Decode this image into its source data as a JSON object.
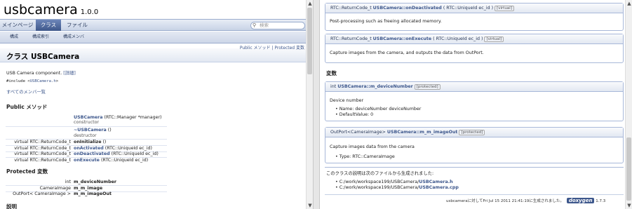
{
  "left": {
    "project_name": "usbcamera",
    "project_version": "1.0.0",
    "main_tabs": [
      "メインページ",
      "クラス",
      "ファイル"
    ],
    "search_placeholder": "検索",
    "sub_tabs": [
      "構成",
      "構成索引",
      "構成メンバ"
    ],
    "summary_links": [
      "Public メソッド",
      "Protected 変数"
    ],
    "summary_separator": " | ",
    "page_title": "クラス USBCamera",
    "brief": "USB Camera component.",
    "detail_link": "[詳細]",
    "include_prefix": "#include <",
    "include_file": "USBCamera.h",
    "include_suffix": ">",
    "all_members_link": "すべてのメンバ一覧",
    "public_methods_heading": "Public メソッド",
    "methods": [
      {
        "type": "",
        "name": "USBCamera",
        "args": " (RTC::Manager *manager)",
        "desc": "constructor"
      },
      {
        "type": "",
        "name": "~USBCamera",
        "args": " ()",
        "desc": "destructor"
      },
      {
        "type": "virtual RTC::ReturnCode_t",
        "name": "onInitialize",
        "args": " ()",
        "desc": ""
      },
      {
        "type": "virtual RTC::ReturnCode_t",
        "name": "onActivated",
        "args": " (RTC::UniqueId ec_id)",
        "desc": ""
      },
      {
        "type": "virtual RTC::ReturnCode_t",
        "name": "onDeactivated",
        "args": " (RTC::UniqueId ec_id)",
        "desc": ""
      },
      {
        "type": "virtual RTC::ReturnCode_t",
        "name": "onExecute",
        "args": " (RTC::UniqueId ec_id)",
        "desc": ""
      }
    ],
    "protected_vars_heading": "Protected 変数",
    "vars": [
      {
        "type": "int",
        "name": "m_deviceNumber"
      },
      {
        "type": "CameraImage",
        "name": "m_m_image"
      },
      {
        "type": "OutPort< CameraImage >",
        "name": "m_m_imageOut"
      }
    ],
    "description_heading": "説明"
  },
  "right": {
    "on_deactivated": {
      "prefix": "RTC::ReturnCode_t ",
      "name": "USBCamera::onDeactivated",
      "args": " ( RTC::UniqueId  ec_id )",
      "tag": "[virtual]",
      "body": "Post-processing such as freeing allocated memory."
    },
    "on_execute": {
      "prefix": "RTC::ReturnCode_t ",
      "name": "USBCamera::onExecute",
      "args": " ( RTC::UniqueId  ec_id )",
      "tag": "[virtual]",
      "body": "Capture images from the camera, and outputs the data from OutPort."
    },
    "variables_heading": "変数",
    "device_number": {
      "prefix": "int ",
      "name": "USBCamera::m_deviceNumber",
      "tag": "[protected]",
      "body": "Device number",
      "bullets": [
        "Name: deviceNumber deviceNumber",
        "DefaultValue: 0"
      ]
    },
    "image_out": {
      "prefix": "OutPort<CameraImage> ",
      "name": "USBCamera::m_m_imageOut",
      "tag": "[protected]",
      "body": "Capture images data from the camera",
      "bullets": [
        "Type: RTC::CameraImage"
      ]
    },
    "generated_from": "このクラスの説明は次のファイルから生成されました:",
    "files": [
      {
        "path": "C:/work/workspace199/USBCamera/",
        "file": "USBCamera.h"
      },
      {
        "path": "C:/work/workspace199/USBCamera/",
        "file": "USBCamera.cpp"
      }
    ],
    "footer_text": "usbcameraに対してFri Jul 15 2011 21:41:19に生成されました。",
    "doxygen_logo": "doxygen",
    "doxygen_version": "1.7.3"
  }
}
